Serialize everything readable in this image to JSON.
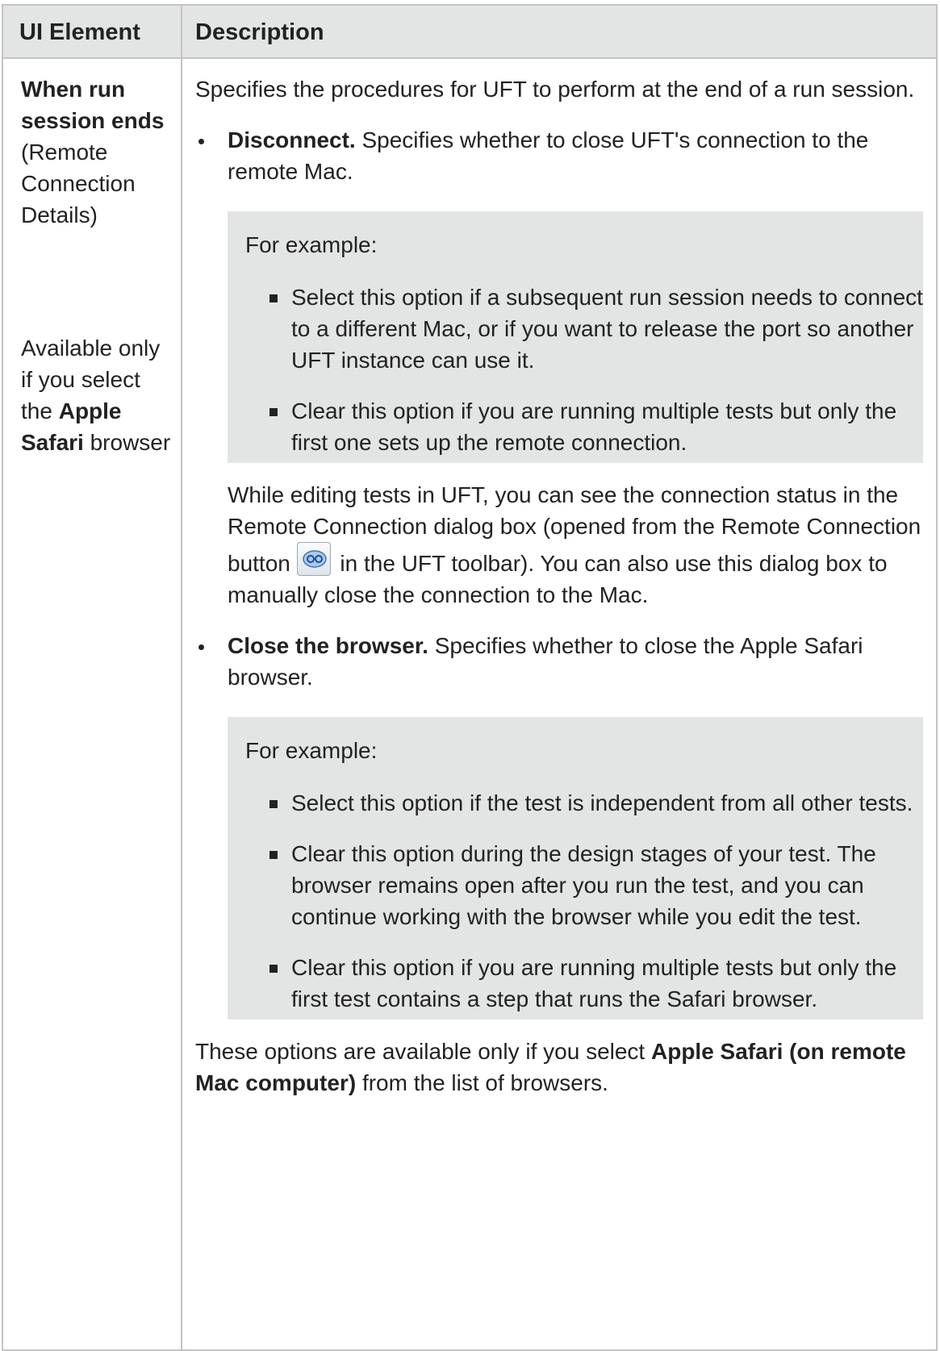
{
  "table": {
    "header": {
      "col1": "UI Element",
      "col2": "Description"
    },
    "row": {
      "element": {
        "name": "When run session ends",
        "context": "(Remote Connection Details)",
        "availability_prefix": "Available only if you select the",
        "availability_bold": "Apple Safari",
        "availability_suffix": "browser"
      },
      "description": {
        "intro": "Specifies the procedures for UFT to perform at the end of a run session.",
        "disconnect": {
          "title": "Disconnect.",
          "text": "Specifies whether to close UFT's connection to the remote Mac.",
          "note_heading": "For example:",
          "note_items": [
            "Select this option if a subsequent run session needs to connect to a different Mac, or if you want to release the port so another UFT instance can use it.",
            "Clear this option if you are running multiple tests but only the first one sets up the remote connection."
          ],
          "follow_before": "While editing tests in UFT, you can see the connection status in the Remote Connection dialog box (opened from the Remote Connection button",
          "follow_after": "in the UFT toolbar). You can also use this dialog box to manually close the connection to the Mac."
        },
        "close_browser": {
          "title": "Close the browser.",
          "text": "Specifies whether to close the Apple Safari browser.",
          "note_heading": "For example:",
          "note_items": [
            "Select this option if the test is independent from all other tests.",
            "Clear this option during the design stages of your test. The browser remains open after you run the test, and you can continue working with the browser while you edit the test.",
            "Clear this option if you are running multiple tests but only the first test contains a step that runs the Safari browser."
          ]
        },
        "footer_prefix": "These options are available only if you select",
        "footer_bold": "Apple Safari (on remote Mac computer)",
        "footer_suffix": "from the list of browsers."
      }
    }
  },
  "icons": {
    "remote_connection": "remote-connection-icon"
  }
}
